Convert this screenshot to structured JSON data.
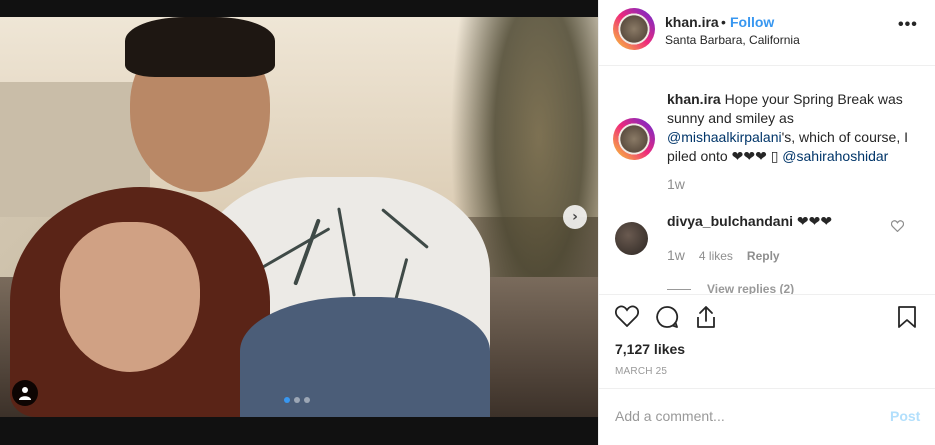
{
  "post": {
    "username": "khan.ira",
    "separator": "•",
    "follow_label": "Follow",
    "location": "Santa Barbara, California",
    "more_label": "•••"
  },
  "caption": {
    "username": "khan.ira",
    "text_1": " Hope your Spring Break was sunny and smiley as ",
    "mention_1": "@mishaalkirpalani",
    "text_2": "'s, which of course, I piled onto ❤❤❤ ▯ ",
    "mention_2": "@sahirahoshidar",
    "time": "1w"
  },
  "comments": [
    {
      "username": "divya_bulchandani",
      "text": " ❤❤❤",
      "time": "1w",
      "likes": "4 likes",
      "reply_label": "Reply"
    }
  ],
  "view_replies_label": "View replies (2)",
  "likes_count": "7,127 likes",
  "date": "MARCH 25",
  "add_comment": {
    "placeholder": "Add a comment...",
    "post_label": "Post"
  },
  "carousel": {
    "next_icon": "chevron-right-icon",
    "slides": 3,
    "active_slide": 1
  },
  "colors": {
    "accent": "#3897f0",
    "post_disabled": "#b2dffc",
    "muted": "#8e8e8e",
    "mention": "#003569"
  }
}
